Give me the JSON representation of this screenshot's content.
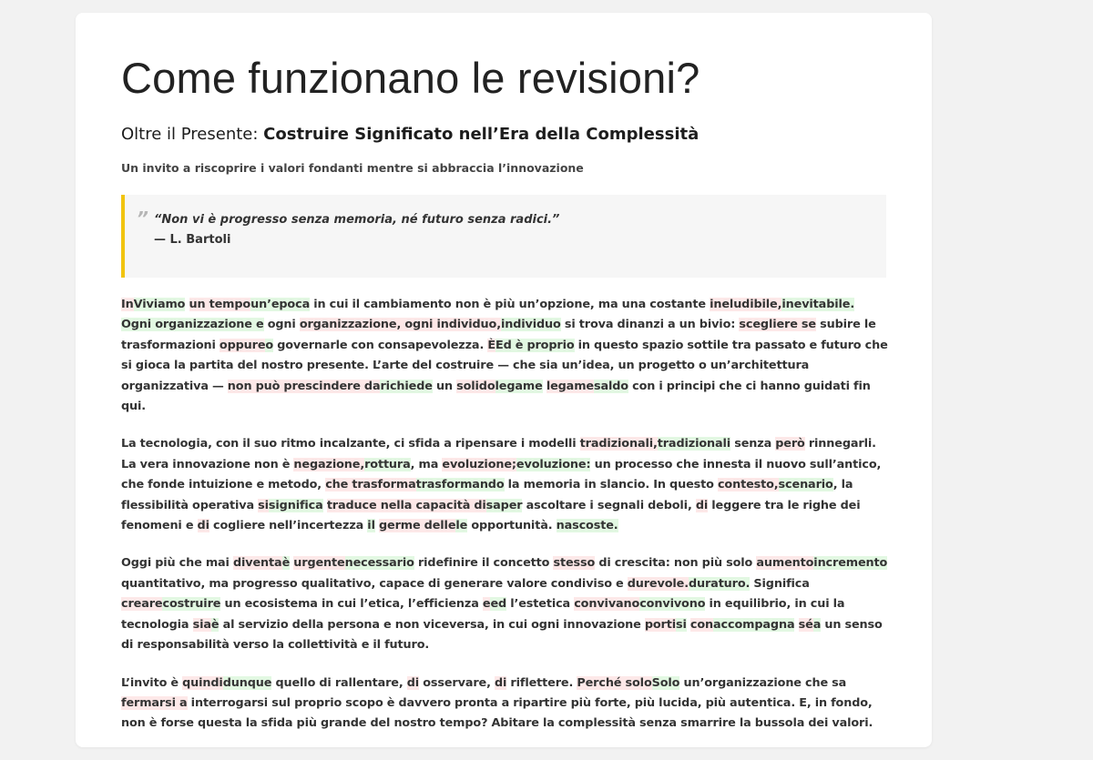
{
  "page": {
    "title": "Come funzionano le revisioni?"
  },
  "article": {
    "subtitle_prefix": "Oltre il Presente: ",
    "subtitle_strong": "Costruire Significato nell’Era della Complessità",
    "tagline": "Un invito a riscoprire i valori fondanti mentre si abbraccia l’innovazione",
    "quote": {
      "mark": "”",
      "text": "“Non vi è progresso senza memoria, né futuro senza radici.”",
      "author": "— L. Bartoli"
    }
  },
  "colors": {
    "accent": "#f1c40f",
    "deleted_highlight": "#fde8e8",
    "inserted_highlight": "#e2f8e2"
  },
  "paragraphs": [
    [
      {
        "t": "In",
        "k": "del"
      },
      {
        "t": "Viviamo",
        "k": "ins"
      },
      {
        "t": " "
      },
      {
        "t": "un tempo",
        "k": "del"
      },
      {
        "t": "un’epoca",
        "k": "ins"
      },
      {
        "t": " in cui il cambiamento non è più un’opzione, ma una costante "
      },
      {
        "t": "ineludibile,",
        "k": "del"
      },
      {
        "t": "inevitabile. Ogni organizzazione e",
        "k": "ins"
      },
      {
        "t": " ogni "
      },
      {
        "t": "organizzazione, ogni individuo,",
        "k": "del"
      },
      {
        "t": "individuo",
        "k": "ins"
      },
      {
        "t": " si trova dinanzi a un bivio: "
      },
      {
        "t": "scegliere se",
        "k": "del"
      },
      {
        "t": " subire le trasformazioni "
      },
      {
        "t": "oppure",
        "k": "del"
      },
      {
        "t": "o",
        "k": "ins"
      },
      {
        "t": " governarle con consapevolezza. "
      },
      {
        "t": "È",
        "k": "del"
      },
      {
        "t": "Ed è proprio",
        "k": "ins"
      },
      {
        "t": " in questo spazio sottile tra passato e futuro che si gioca la partita del nostro presente. L’arte del costruire — che sia un’idea, un progetto o un’architettura organizzativa — "
      },
      {
        "t": "non può prescindere da",
        "k": "del"
      },
      {
        "t": "richiede",
        "k": "ins"
      },
      {
        "t": " un "
      },
      {
        "t": "solido",
        "k": "del"
      },
      {
        "t": "legame",
        "k": "ins"
      },
      {
        "t": " "
      },
      {
        "t": "legame",
        "k": "del"
      },
      {
        "t": "saldo",
        "k": "ins"
      },
      {
        "t": " con i principi che ci hanno guidati fin qui."
      }
    ],
    [
      {
        "t": "La tecnologia, con il suo ritmo incalzante, ci sfida a ripensare i modelli "
      },
      {
        "t": "tradizionali,",
        "k": "del"
      },
      {
        "t": "tradizionali",
        "k": "ins"
      },
      {
        "t": " senza "
      },
      {
        "t": "però",
        "k": "del"
      },
      {
        "t": " rinnegarli. La vera innovazione non è "
      },
      {
        "t": "negazione,",
        "k": "del"
      },
      {
        "t": "rottura",
        "k": "ins"
      },
      {
        "t": ", ma "
      },
      {
        "t": "evoluzione;",
        "k": "del"
      },
      {
        "t": "evoluzione:",
        "k": "ins"
      },
      {
        "t": " un processo che innesta il nuovo sull’antico, che fonde intuizione e metodo, "
      },
      {
        "t": "che trasforma",
        "k": "del"
      },
      {
        "t": "trasformando",
        "k": "ins"
      },
      {
        "t": " la memoria in slancio. In questo "
      },
      {
        "t": "contesto,",
        "k": "del"
      },
      {
        "t": "scenario",
        "k": "ins"
      },
      {
        "t": ", la flessibilità operativa "
      },
      {
        "t": "si",
        "k": "del"
      },
      {
        "t": "significa",
        "k": "ins"
      },
      {
        "t": " "
      },
      {
        "t": "traduce nella capacità di",
        "k": "del"
      },
      {
        "t": "saper",
        "k": "ins"
      },
      {
        "t": " ascoltare i segnali deboli, "
      },
      {
        "t": "di",
        "k": "del"
      },
      {
        "t": " leggere tra le righe dei fenomeni e "
      },
      {
        "t": "di",
        "k": "del"
      },
      {
        "t": " cogliere nell’incertezza "
      },
      {
        "t": "il",
        "k": "ins"
      },
      {
        "t": " "
      },
      {
        "t": "germe delle",
        "k": "del"
      },
      {
        "t": "le",
        "k": "ins"
      },
      {
        "t": " opportunità. "
      },
      {
        "t": "nascoste.",
        "k": "ins"
      }
    ],
    [
      {
        "t": "Oggi più che mai "
      },
      {
        "t": "diventa",
        "k": "del"
      },
      {
        "t": "è",
        "k": "ins"
      },
      {
        "t": " "
      },
      {
        "t": "urgente",
        "k": "del"
      },
      {
        "t": "necessario",
        "k": "ins"
      },
      {
        "t": " ridefinire il concetto "
      },
      {
        "t": "stesso",
        "k": "del"
      },
      {
        "t": " di crescita: non più solo "
      },
      {
        "t": "aumento",
        "k": "del"
      },
      {
        "t": "incremento",
        "k": "ins"
      },
      {
        "t": " quantitativo, ma progresso qualitativo, capace di generare valore condiviso e "
      },
      {
        "t": "durevole.",
        "k": "del"
      },
      {
        "t": "duraturo.",
        "k": "ins"
      },
      {
        "t": " Significa "
      },
      {
        "t": "creare",
        "k": "del"
      },
      {
        "t": "costruire",
        "k": "ins"
      },
      {
        "t": " un ecosistema in cui l’etica, l’efficienza "
      },
      {
        "t": "e",
        "k": "del"
      },
      {
        "t": "ed",
        "k": "ins"
      },
      {
        "t": " l’estetica "
      },
      {
        "t": "convivano",
        "k": "del"
      },
      {
        "t": "convivono",
        "k": "ins"
      },
      {
        "t": " in equilibrio, in cui la tecnologia "
      },
      {
        "t": "sia",
        "k": "del"
      },
      {
        "t": "è",
        "k": "ins"
      },
      {
        "t": " al servizio della persona e non viceversa, in cui ogni innovazione "
      },
      {
        "t": "porti",
        "k": "del"
      },
      {
        "t": "si",
        "k": "ins"
      },
      {
        "t": " "
      },
      {
        "t": "con",
        "k": "del"
      },
      {
        "t": "accompagna",
        "k": "ins"
      },
      {
        "t": " "
      },
      {
        "t": "sé",
        "k": "del"
      },
      {
        "t": "a",
        "k": "ins"
      },
      {
        "t": " un senso di responsabilità verso la collettività e il futuro."
      }
    ],
    [
      {
        "t": "L’invito è "
      },
      {
        "t": "quindi",
        "k": "del"
      },
      {
        "t": "dunque",
        "k": "ins"
      },
      {
        "t": " quello di rallentare, "
      },
      {
        "t": "di",
        "k": "del"
      },
      {
        "t": " osservare, "
      },
      {
        "t": "di",
        "k": "del"
      },
      {
        "t": " riflettere. "
      },
      {
        "t": "Perché solo",
        "k": "del"
      },
      {
        "t": "Solo",
        "k": "ins"
      },
      {
        "t": " un’organizzazione che sa "
      },
      {
        "t": "fermarsi a",
        "k": "del"
      },
      {
        "t": " interrogarsi sul proprio scopo è davvero pronta a ripartire più forte, più lucida, più autentica. E, in fondo, non è forse questa la sfida più grande del nostro tempo? Abitare la complessità senza smarrire la bussola dei valori."
      }
    ]
  ]
}
